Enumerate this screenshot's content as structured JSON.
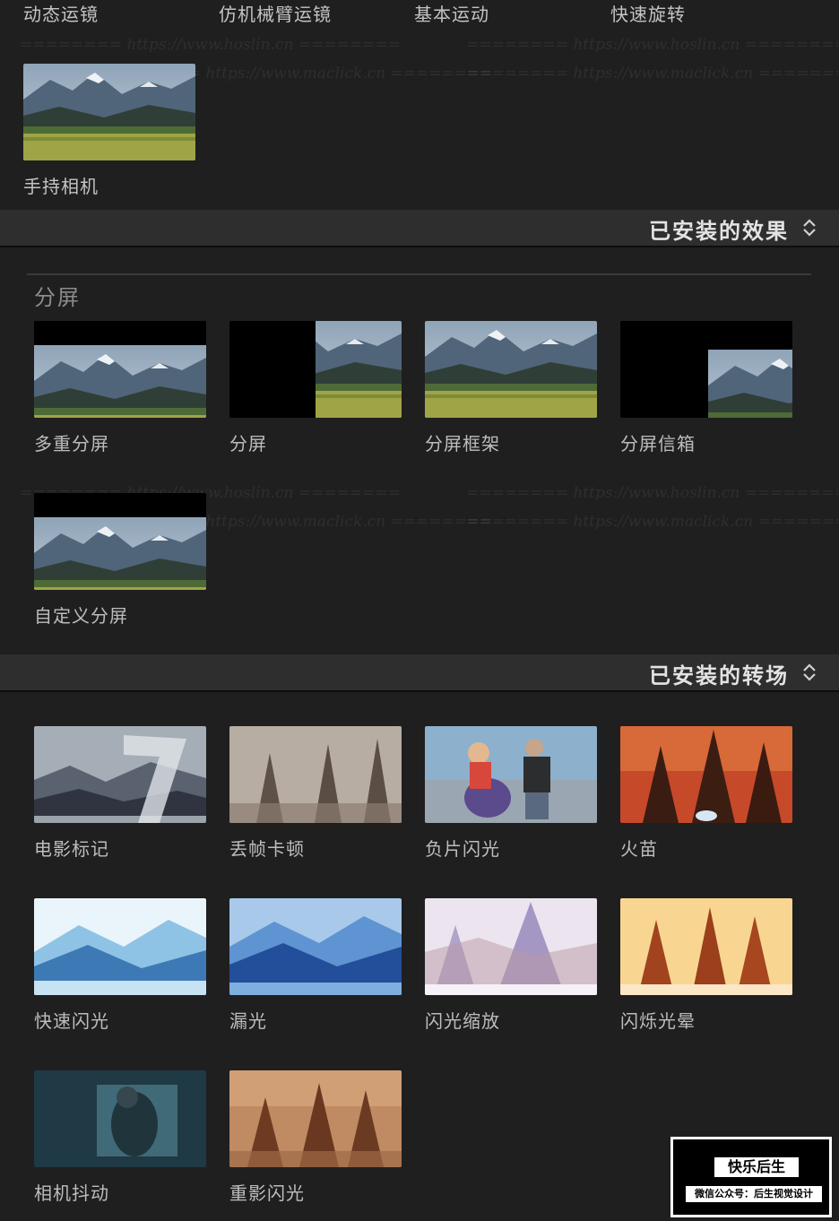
{
  "top_row": {
    "labels": [
      "动态运镜",
      "仿机械臂运镜",
      "基本运动",
      "快速旋转"
    ],
    "handheld": {
      "label": "手持相机"
    }
  },
  "effects_section": {
    "title": "已安装的效果"
  },
  "split_group": {
    "title": "分屏",
    "items": [
      {
        "label": "多重分屏"
      },
      {
        "label": "分屏"
      },
      {
        "label": "分屏框架"
      },
      {
        "label": "分屏信箱"
      },
      {
        "label": "自定义分屏"
      }
    ]
  },
  "transitions_section": {
    "title": "已安装的转场"
  },
  "transitions": [
    {
      "label": "电影标记"
    },
    {
      "label": "丢帧卡顿"
    },
    {
      "label": "负片闪光"
    },
    {
      "label": "火苗"
    },
    {
      "label": "快速闪光"
    },
    {
      "label": "漏光"
    },
    {
      "label": "闪光缩放"
    },
    {
      "label": "闪烁光晕"
    },
    {
      "label": "相机抖动"
    },
    {
      "label": "重影闪光"
    }
  ],
  "watermarks": [
    "======== https://www.hoslin.cn ========",
    "======== https://www.maclick.cn ========"
  ],
  "logo": {
    "name": "快乐后生",
    "subtitle": "微信公众号：后生视觉设计"
  },
  "icons": {
    "sort": "chevron-up-down-icon"
  },
  "colors": {
    "background": "#1f1f20",
    "section_bar": "#2e2e2f",
    "text": "#bdbdbd"
  }
}
